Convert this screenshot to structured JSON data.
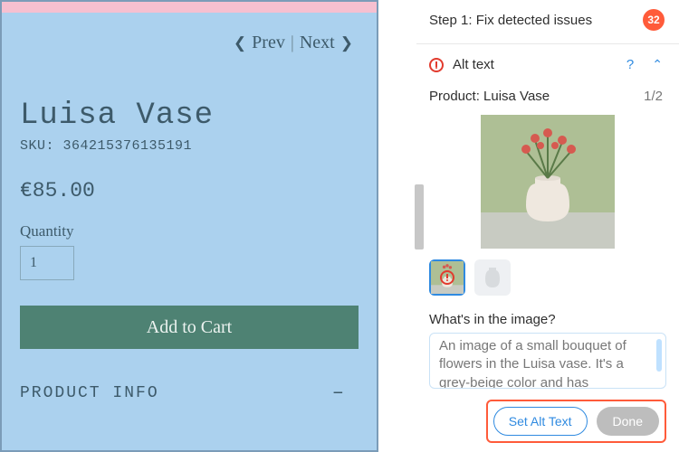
{
  "pager": {
    "prev": "Prev",
    "next": "Next"
  },
  "product": {
    "title": "Luisa Vase",
    "sku_label": "SKU: 364215376135191",
    "price": "€85.00",
    "quantity_label": "Quantity",
    "quantity_value": "1",
    "add_to_cart": "Add to Cart",
    "accordion": {
      "info": "PRODUCT INFO",
      "toggle": "–"
    }
  },
  "panel": {
    "step_title": "Step 1: Fix detected issues",
    "badge": "32",
    "section": "Alt text",
    "help": "?",
    "collapse": "⌃",
    "product_label": "Product: Luisa Vase",
    "counter": "1/2",
    "prompt": "What's in the image?",
    "alt_text": "An image of a small bouquet of flowers in the Luisa vase. It's a grey-beige color and has",
    "set_alt": "Set Alt Text",
    "done": "Done",
    "thumbs": {
      "count": 2,
      "selected_index": 0
    }
  }
}
